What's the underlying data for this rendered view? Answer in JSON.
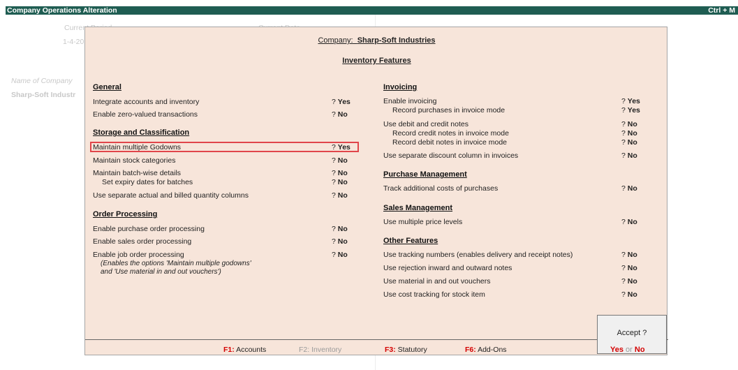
{
  "titlebar": {
    "title": "Company Operations  Alteration",
    "shortcut": "Ctrl + M"
  },
  "background": {
    "date_label": "Current Period",
    "date_value": "1-4-20",
    "date_right": "Current Date",
    "name_label": "Name of Company",
    "name_value": "Sharp-Soft Industr"
  },
  "dialog": {
    "company_label": "Company:",
    "company_name": "Sharp-Soft Industries",
    "title": "Inventory Features",
    "left": {
      "general": {
        "heading": "General",
        "items": [
          {
            "label": "Integrate accounts and inventory",
            "value": "Yes"
          },
          {
            "label": "Enable zero-valued transactions",
            "value": "No"
          }
        ]
      },
      "storage": {
        "heading": "Storage and Classification",
        "items": [
          {
            "label": "Maintain multiple Godowns",
            "value": "Yes"
          },
          {
            "label": "Maintain stock categories",
            "value": "No"
          },
          {
            "label": "Maintain batch-wise details",
            "value": "No"
          },
          {
            "label": "Set expiry dates for batches",
            "value": "No"
          },
          {
            "label": "Use separate actual and billed quantity columns",
            "value": "No"
          }
        ]
      },
      "order": {
        "heading": "Order Processing",
        "items": [
          {
            "label": "Enable purchase order processing",
            "value": "No"
          },
          {
            "label": "Enable sales order processing",
            "value": "No"
          },
          {
            "label": "Enable job order processing",
            "value": "No"
          }
        ],
        "note1": "(Enables the options 'Maintain multiple godowns'",
        "note2": "and 'Use material in and out vouchers')"
      }
    },
    "right": {
      "invoicing": {
        "heading": "Invoicing",
        "items": [
          {
            "label": "Enable invoicing",
            "value": "Yes"
          },
          {
            "label": "Record purchases in invoice mode",
            "value": "Yes"
          },
          {
            "label": "Use debit and credit notes",
            "value": "No"
          },
          {
            "label": "Record credit notes in invoice mode",
            "value": "No"
          },
          {
            "label": "Record debit notes in invoice mode",
            "value": "No"
          },
          {
            "label": "Use separate discount column in invoices",
            "value": "No"
          }
        ]
      },
      "purchase": {
        "heading": "Purchase Management",
        "items": [
          {
            "label": "Track additional costs of purchases",
            "value": "No"
          }
        ]
      },
      "sales": {
        "heading": "Sales Management",
        "items": [
          {
            "label": "Use multiple price levels",
            "value": "No"
          }
        ]
      },
      "other": {
        "heading": "Other Features",
        "items": [
          {
            "label": "Use tracking numbers (enables delivery and receipt notes)",
            "value": "No"
          },
          {
            "label": "Use rejection inward and outward notes",
            "value": "No"
          },
          {
            "label": "Use material in and out vouchers",
            "value": "No"
          },
          {
            "label": "Use cost tracking for stock item",
            "value": "No"
          }
        ]
      }
    },
    "qmark": "?",
    "footer": {
      "f1_key": "F1:",
      "f1_label": "Accounts",
      "f2_key": "F2:",
      "f2_label": "Inventory",
      "f3_key": "F3:",
      "f3_label": "Statutory",
      "f6_key": "F6:",
      "f6_label": "Add-Ons"
    },
    "accept": {
      "question": "Accept ?",
      "yes": "Yes",
      "or": "or",
      "no": "No"
    }
  },
  "colors": {
    "titlebar": "#1f5d52",
    "dialog_bg": "#f7e5da",
    "highlight": "#e0454a",
    "hotkey": "#d40000"
  }
}
